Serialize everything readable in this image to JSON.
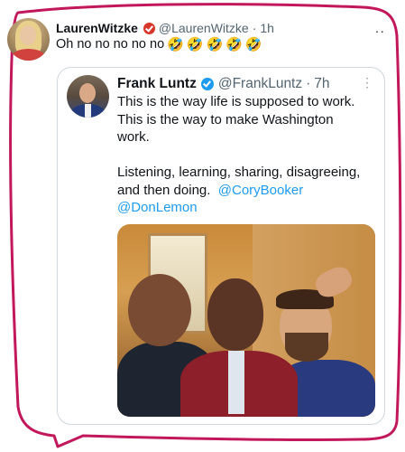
{
  "outer_tweet": {
    "display_name": "LaurenWitzke",
    "handle": "@LaurenWitzke",
    "time": "1h",
    "text": "Oh no no no no no",
    "emoji": "🤣",
    "emoji_count": 5,
    "more_icon": "dots-icon",
    "verified_color": "#d8352a"
  },
  "quoted_tweet": {
    "display_name": "Frank Luntz",
    "handle": "@FrankLuntz",
    "time": "7h",
    "more_icon": "dots-icon",
    "verified_color": "#1d9bf0",
    "line1": "This is the way life is supposed to work.",
    "line2": "This is the way to make Washington",
    "line3": "work.",
    "line4": "Listening, learning, sharing, disagreeing,",
    "line5_text": "and then doing.",
    "mention1": "@CoryBooker",
    "mention2": "@DonLemon"
  },
  "colors": {
    "frame_stroke": "#c2185b",
    "link": "#1d9bf0",
    "muted": "#536471"
  }
}
